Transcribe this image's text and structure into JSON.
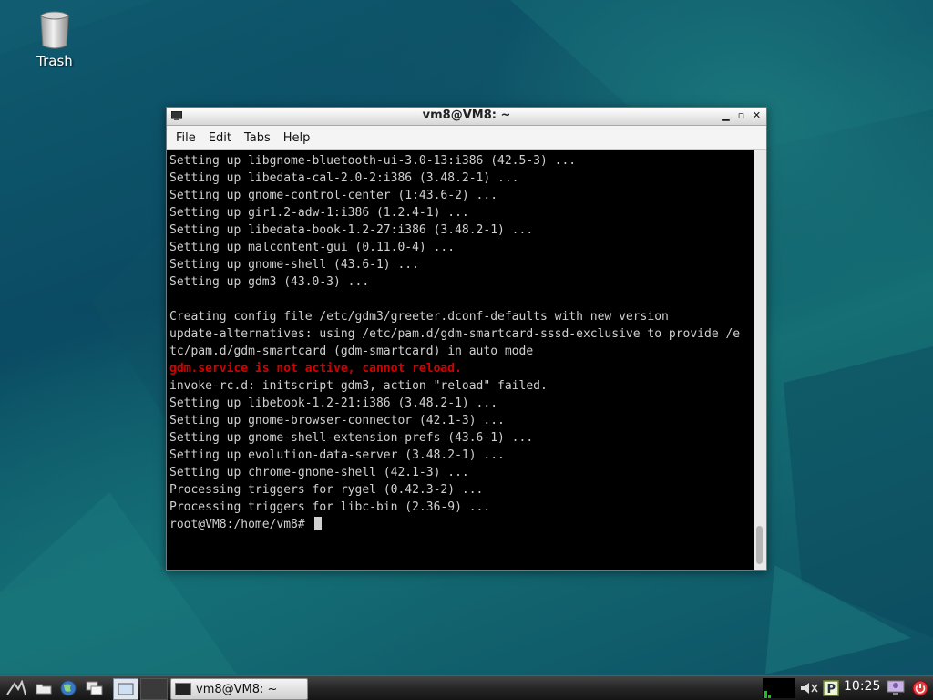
{
  "desktop": {
    "trash_label": "Trash"
  },
  "window": {
    "title": "vm8@VM8: ~",
    "menu": [
      "File",
      "Edit",
      "Tabs",
      "Help"
    ],
    "terminal_lines": [
      {
        "text": "Setting up libgnome-bluetooth-ui-3.0-13:i386 (42.5-3) ...",
        "error": false
      },
      {
        "text": "Setting up libedata-cal-2.0-2:i386 (3.48.2-1) ...",
        "error": false
      },
      {
        "text": "Setting up gnome-control-center (1:43.6-2) ...",
        "error": false
      },
      {
        "text": "Setting up gir1.2-adw-1:i386 (1.2.4-1) ...",
        "error": false
      },
      {
        "text": "Setting up libedata-book-1.2-27:i386 (3.48.2-1) ...",
        "error": false
      },
      {
        "text": "Setting up malcontent-gui (0.11.0-4) ...",
        "error": false
      },
      {
        "text": "Setting up gnome-shell (43.6-1) ...",
        "error": false
      },
      {
        "text": "Setting up gdm3 (43.0-3) ...",
        "error": false
      },
      {
        "text": "",
        "error": false
      },
      {
        "text": "Creating config file /etc/gdm3/greeter.dconf-defaults with new version",
        "error": false
      },
      {
        "text": "update-alternatives: using /etc/pam.d/gdm-smartcard-sssd-exclusive to provide /e",
        "error": false
      },
      {
        "text": "tc/pam.d/gdm-smartcard (gdm-smartcard) in auto mode",
        "error": false
      },
      {
        "text": "gdm.service is not active, cannot reload.",
        "error": true
      },
      {
        "text": "invoke-rc.d: initscript gdm3, action \"reload\" failed.",
        "error": false
      },
      {
        "text": "Setting up libebook-1.2-21:i386 (3.48.2-1) ...",
        "error": false
      },
      {
        "text": "Setting up gnome-browser-connector (42.1-3) ...",
        "error": false
      },
      {
        "text": "Setting up gnome-shell-extension-prefs (43.6-1) ...",
        "error": false
      },
      {
        "text": "Setting up evolution-data-server (3.48.2-1) ...",
        "error": false
      },
      {
        "text": "Setting up chrome-gnome-shell (42.1-3) ...",
        "error": false
      },
      {
        "text": "Processing triggers for rygel (0.42.3-2) ...",
        "error": false
      },
      {
        "text": "Processing triggers for libc-bin (2.36-9) ...",
        "error": false
      }
    ],
    "prompt": "root@VM8:/home/vm8# "
  },
  "taskbar": {
    "task_label": "vm8@VM8: ~",
    "clock": "10:25"
  },
  "colors": {
    "error_text": "#d40000",
    "terminal_bg": "#000000",
    "terminal_fg": "#d0d0d0"
  }
}
